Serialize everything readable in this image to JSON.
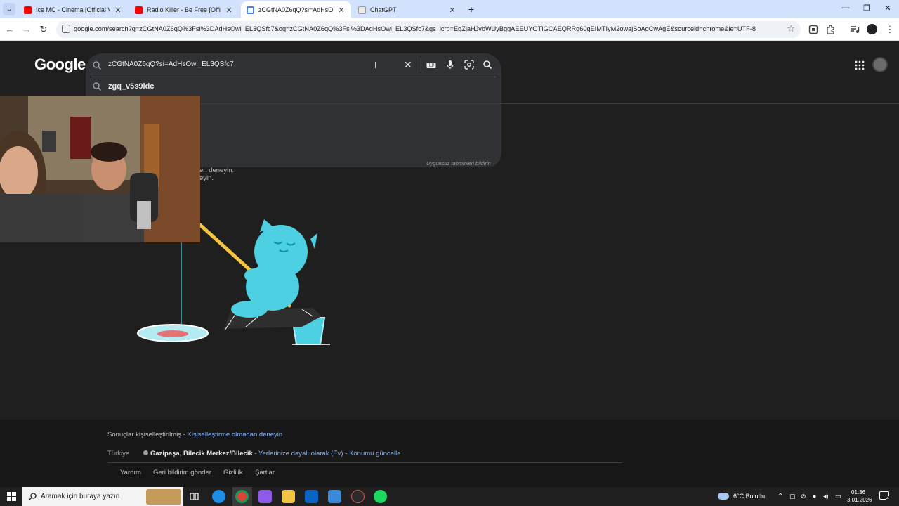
{
  "tabs": [
    {
      "title": "Ice MC - Cinema [Official Video]",
      "favicon": "youtube-icon",
      "active": false
    },
    {
      "title": "Radio Killer - Be Free [Official Video]",
      "favicon": "youtube-icon",
      "active": false
    },
    {
      "title": "zCGtNA0Z6qQ?si=AdHsOwi_EL3QSfc7",
      "favicon": "google-icon",
      "active": true
    },
    {
      "title": "ChatGPT",
      "favicon": "chatgpt-icon",
      "active": false
    }
  ],
  "address_bar": {
    "url": "google.com/search?q=zCGtNA0Z6qQ%3Fsi%3DAdHsOwi_EL3QSfc7&oq=zCGtNA0Z6qQ%3Fsi%3DAdHsOwi_EL3QSfc7&gs_lcrp=EgZjaHJvbWUyBggAEEUYOTIGCAEQRRg60gEIMTIyM2owajSoAgCwAgE&sourceid=chrome&ie=UTF-8"
  },
  "google": {
    "logo": "Google",
    "query": "zCGtNA0Z6qQ?si=AdHsOwi_EL3QSfc7",
    "suggestion": "zgq_v5s9ldc",
    "report_link": "Uygunsuz tahminleri bildirin",
    "no_results_line1": "eri deneyin.",
    "no_results_line2": "eyin."
  },
  "footer": {
    "personalized_text": "Sonuçlar kişiselleştirilmiş - ",
    "personalized_link": "Kişiselleştirme olmadan deneyin",
    "country": "Türkiye",
    "location_bold": "Gazipaşa, Bilecik Merkez/Bilecik",
    "location_sep": " - ",
    "location_basis": "Yerlerinize dayalı olarak (Ev)",
    "location_sep2": " - ",
    "location_update": "Konumu güncelle",
    "links": [
      "Yardım",
      "Geri bildirim gönder",
      "Gizlilik",
      "Şartlar"
    ]
  },
  "taskbar": {
    "search_placeholder": "Aramak için buraya yazın",
    "weather": "6°C  Bulutlu",
    "time": "01:36",
    "date": "3.01.2026",
    "notifications": "4"
  },
  "colors": {
    "tabstrip": "#d3e3fd",
    "page_bg": "#1f1f1f",
    "searchbox": "#303134",
    "link": "#8ab4f8",
    "illustration": "#4dd0e1"
  }
}
